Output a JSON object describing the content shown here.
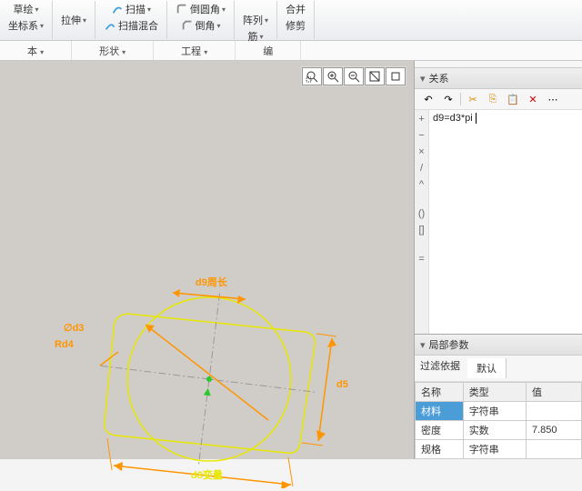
{
  "ribbon": {
    "g1": {
      "a": "草绘",
      "b": "坐标系"
    },
    "g2": {
      "a": "拉伸"
    },
    "g3": {
      "a": "扫描",
      "b": "扫描混合"
    },
    "g4": {
      "a": "倒圆角",
      "b": "倒角"
    },
    "g5": {
      "a": "阵列",
      "b": "筋"
    },
    "g6": {
      "a": "合并",
      "b": "修剪"
    }
  },
  "subtabs": {
    "a": "本",
    "b": "形状",
    "c": "工程",
    "d": "编"
  },
  "relations": {
    "title": "关系",
    "expr": "d9=d3*pi"
  },
  "localparams": {
    "title": "局部参数",
    "filter": "过滤依据",
    "default": "默认",
    "cols": {
      "name": "名称",
      "type": "类型",
      "value": "值"
    },
    "rows": [
      {
        "name": "材料",
        "type": "字符串",
        "value": ""
      },
      {
        "name": "密度",
        "type": "实数",
        "value": "7.850"
      },
      {
        "name": "规格",
        "type": "字符串",
        "value": ""
      }
    ]
  },
  "dims": {
    "d9": "d9周长",
    "d3": "∅d3",
    "d4": "Rd4",
    "d5": "d5",
    "d8": "d8变量"
  }
}
